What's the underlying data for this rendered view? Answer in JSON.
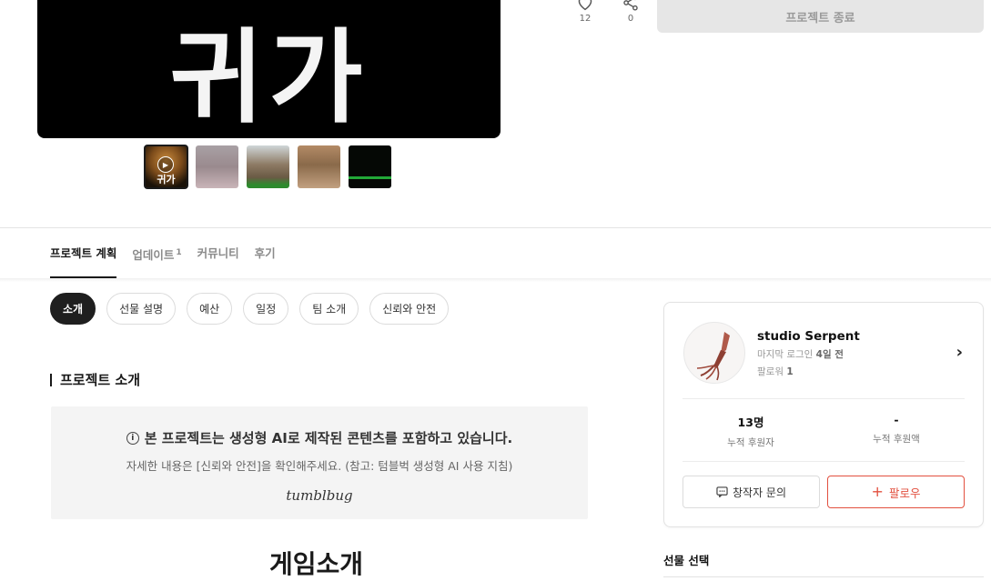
{
  "hero": {
    "title_art": "귀가"
  },
  "thumbnails": [
    {
      "label": "귀가",
      "is_video": true,
      "active": true
    },
    {
      "label": "",
      "is_video": false,
      "active": false
    },
    {
      "label": "",
      "is_video": false,
      "active": false
    },
    {
      "label": "",
      "is_video": false,
      "active": false
    },
    {
      "label": "",
      "is_video": false,
      "active": false
    }
  ],
  "actions": {
    "like_count": "12",
    "share_count": "0",
    "end_button_label": "프로젝트 종료"
  },
  "tabs": [
    {
      "label": "프로젝트 계획",
      "active": true,
      "badge": ""
    },
    {
      "label": "업데이트",
      "active": false,
      "badge": "1"
    },
    {
      "label": "커뮤니티",
      "active": false,
      "badge": ""
    },
    {
      "label": "후기",
      "active": false,
      "badge": ""
    }
  ],
  "chips": [
    {
      "label": "소개",
      "active": true
    },
    {
      "label": "선물 설명",
      "active": false
    },
    {
      "label": "예산",
      "active": false
    },
    {
      "label": "일정",
      "active": false
    },
    {
      "label": "팀 소개",
      "active": false
    },
    {
      "label": "신뢰와 안전",
      "active": false
    }
  ],
  "section": {
    "title": "프로젝트 소개"
  },
  "notice": {
    "title": "본 프로젝트는 생성형 AI로 제작된 콘텐츠를 포함하고 있습니다.",
    "subtitle": "자세한 내용은 [신뢰와 안전]을 확인해주세요. (참고: 텀블벅 생성형 AI 사용 지침)",
    "brand": "tumblbug"
  },
  "game_title": "게임소개",
  "creator": {
    "name": "studio Serpent",
    "last_login_label": "마지막 로그인",
    "last_login_value": "4일 전",
    "followers_label": "팔로워",
    "followers_value": "1",
    "stats": [
      {
        "value": "13명",
        "label": "누적 후원자"
      },
      {
        "value": "-",
        "label": "누적 후원액"
      }
    ],
    "inquiry_label": "창작자 문의",
    "follow_label": "팔로우"
  },
  "reward": {
    "title": "선물 선택"
  },
  "colors": {
    "accent": "#e2503f",
    "dark": "#1f1f1f",
    "muted": "#8a8a8a"
  }
}
